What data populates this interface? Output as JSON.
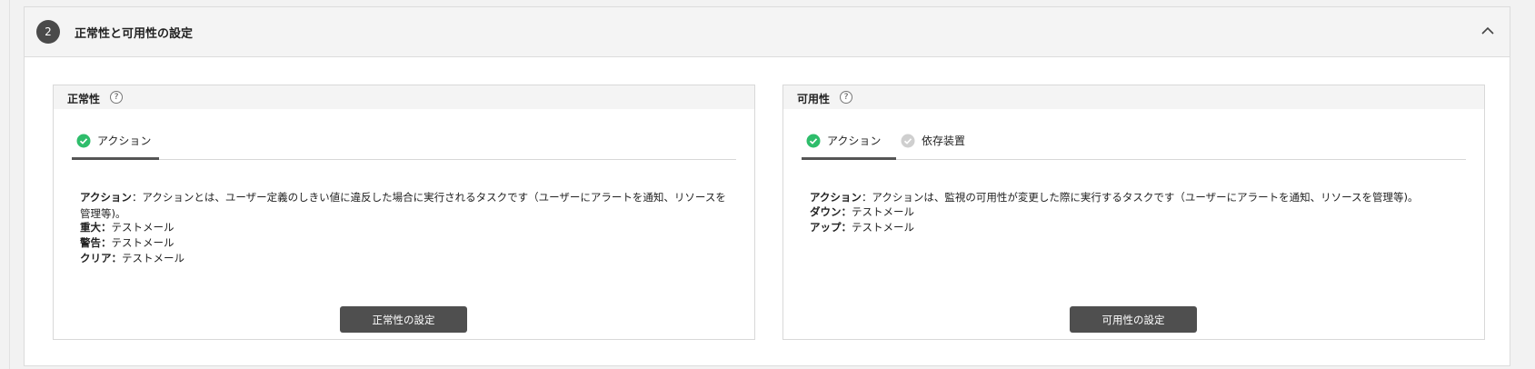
{
  "section": {
    "step_number": "2",
    "title": "正常性と可用性の設定"
  },
  "health": {
    "title": "正常性",
    "help": "?",
    "tabs": [
      {
        "label": "アクション",
        "status": "complete"
      }
    ],
    "description_term": "アクション",
    "description_text": "：アクションとは、ユーザー定義のしきい値に違反した場合に実行されるタスクです（ユーザーにアラートを通知、リソースを管理等)。",
    "items": [
      {
        "key": "重大：",
        "value": "テストメール"
      },
      {
        "key": "警告：",
        "value": "テストメール"
      },
      {
        "key": "クリア：",
        "value": "テストメール"
      }
    ],
    "button_label": "正常性の設定"
  },
  "availability": {
    "title": "可用性",
    "help": "?",
    "tabs": [
      {
        "label": "アクション",
        "status": "complete"
      },
      {
        "label": "依存装置",
        "status": "pending"
      }
    ],
    "description_term": "アクション",
    "description_text": "：アクションは、監視の可用性が変更した際に実行するタスクです（ユーザーにアラートを通知、リソースを管理等)。",
    "items": [
      {
        "key": "ダウン：",
        "value": "テストメール"
      },
      {
        "key": "アップ：",
        "value": "テストメール"
      }
    ],
    "button_label": "可用性の設定"
  },
  "colors": {
    "complete": "#2ebd6b",
    "pending": "#cfcfcf",
    "button": "#4f4f4f"
  }
}
